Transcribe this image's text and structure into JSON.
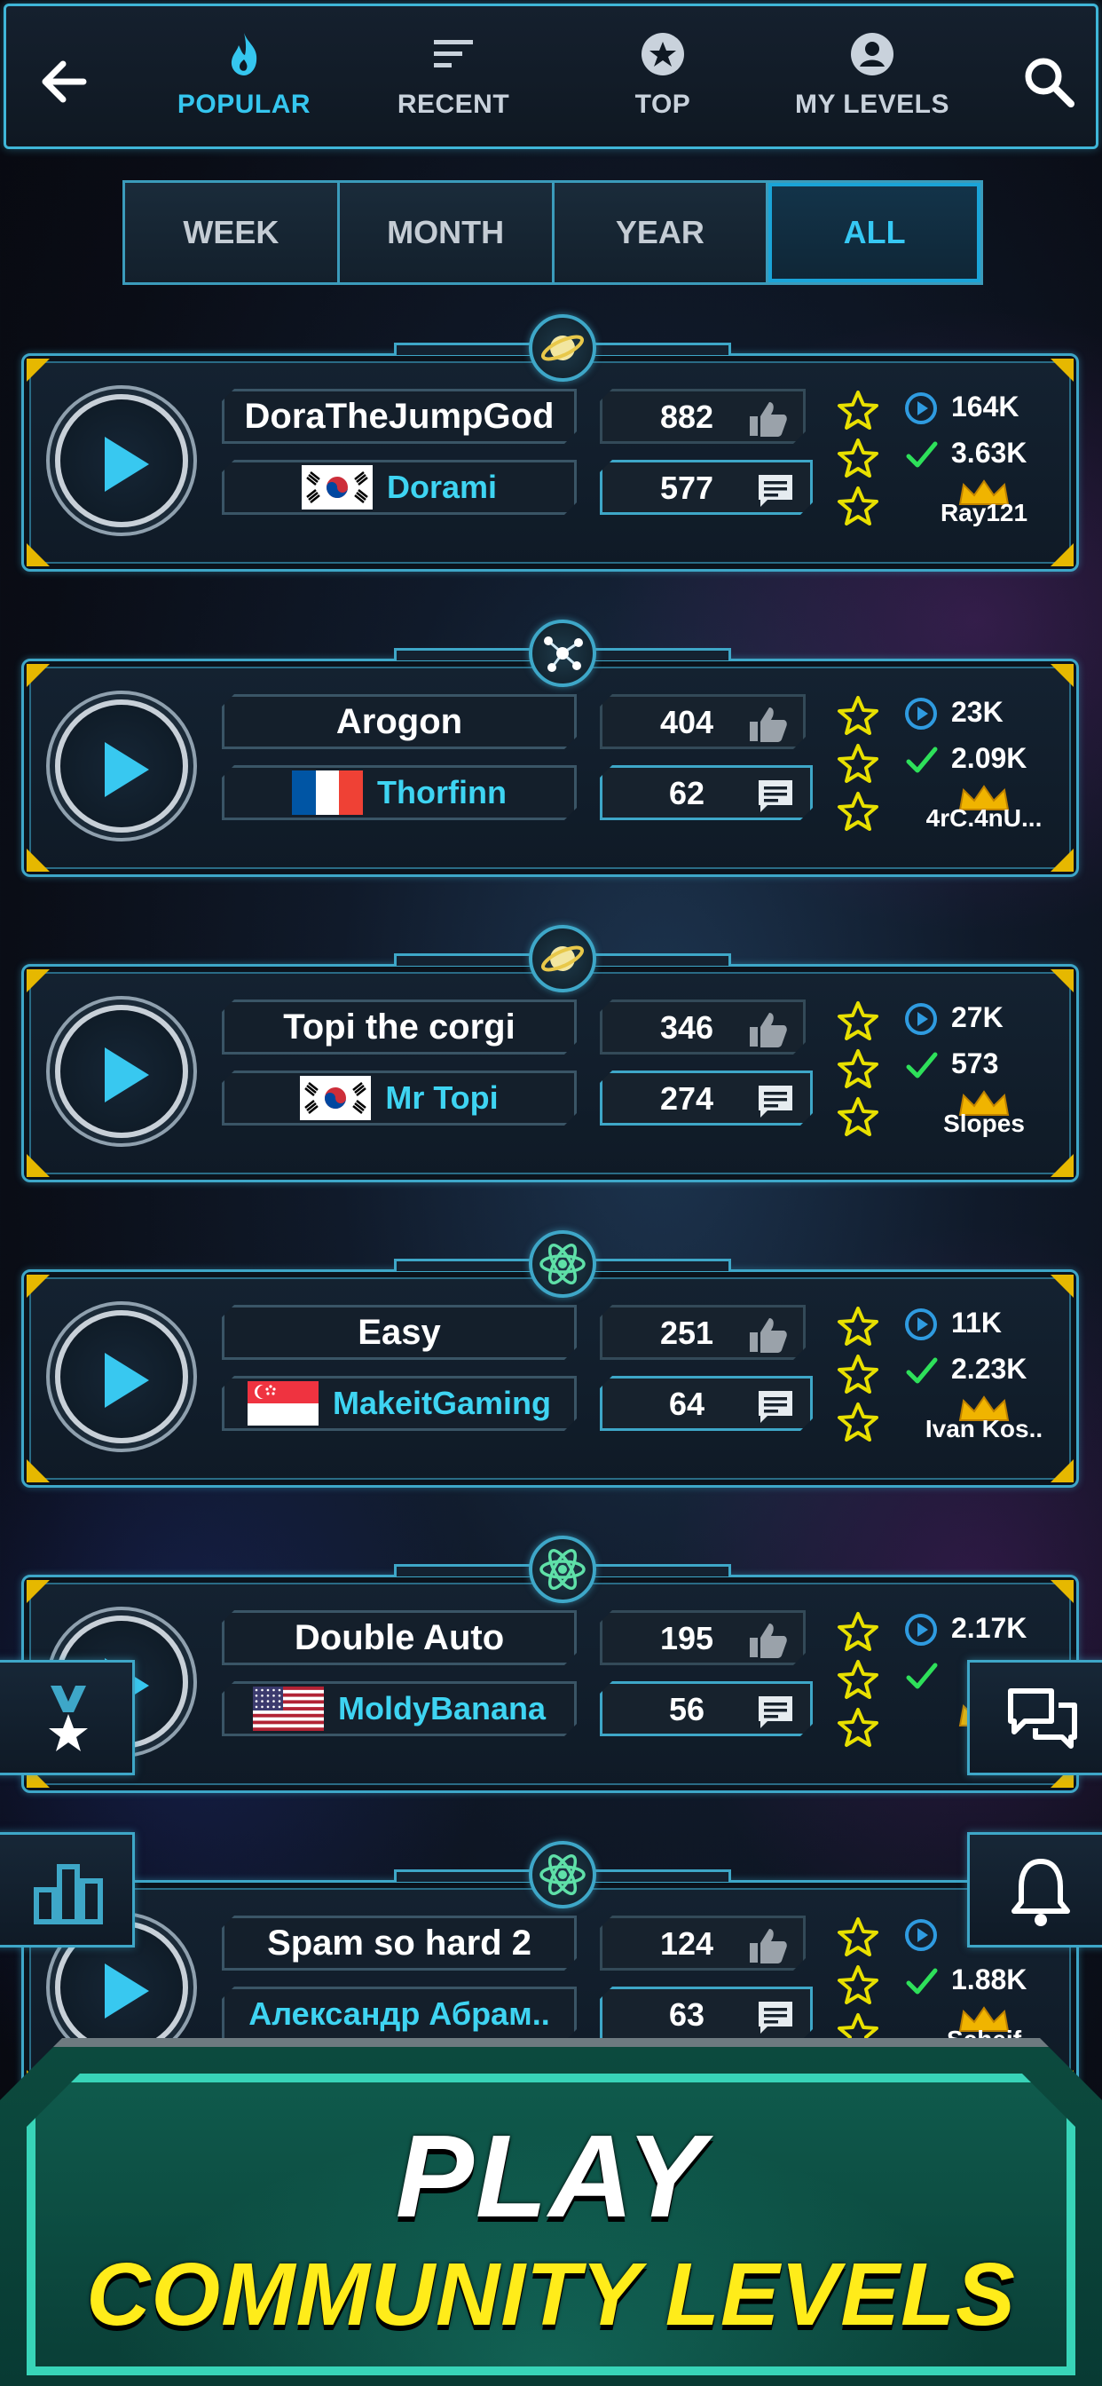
{
  "nav": {
    "tabs": [
      {
        "label": "POPULAR",
        "icon": "flame-icon",
        "active": true
      },
      {
        "label": "RECENT",
        "icon": "lines-icon",
        "active": false
      },
      {
        "label": "TOP",
        "icon": "star-badge-icon",
        "active": false
      },
      {
        "label": "MY LEVELS",
        "icon": "user-icon",
        "active": false
      }
    ]
  },
  "periods": [
    "WEEK",
    "MONTH",
    "YEAR",
    "ALL"
  ],
  "active_period": "ALL",
  "levels": [
    {
      "name": "DoraTheJumpGod",
      "author": "Dorami",
      "flag": "south-korea",
      "likes": "882",
      "comments": "577",
      "plays": "164K",
      "completions": "3.63K",
      "record_holder": "Ray121",
      "category": "planet-icon"
    },
    {
      "name": "Arogon",
      "author": "Thorfinn",
      "flag": "france",
      "likes": "404",
      "comments": "62",
      "plays": "23K",
      "completions": "2.09K",
      "record_holder": "4rC.4nU...",
      "category": "molecule-icon"
    },
    {
      "name": "Topi the corgi",
      "author": "Mr Topi",
      "flag": "south-korea",
      "likes": "346",
      "comments": "274",
      "plays": "27K",
      "completions": "573",
      "record_holder": "Slopes",
      "category": "planet-icon"
    },
    {
      "name": "Easy",
      "author": "MakeitGaming",
      "flag": "singapore",
      "likes": "251",
      "comments": "64",
      "plays": "11K",
      "completions": "2.23K",
      "record_holder": "Ivan Kos..",
      "category": "atom-icon"
    },
    {
      "name": "Double Auto",
      "author": "MoldyBanana",
      "flag": "usa",
      "likes": "195",
      "comments": "56",
      "plays": "2.17K",
      "completions": "",
      "record_holder": "",
      "category": "atom-icon"
    },
    {
      "name": "Spam so hard 2",
      "author": "Александр Абрам..",
      "flag": "",
      "likes": "124",
      "comments": "63",
      "plays": "",
      "completions": "1.88K",
      "record_holder": "Scheif",
      "category": "atom-icon"
    }
  ],
  "banner": {
    "title": "PLAY",
    "subtitle": "COMMUNITY LEVELS"
  },
  "colors": {
    "accent": "#35c6ef",
    "star": "#e8e000",
    "author": "#3ed4f2",
    "subtitle": "#ffec1a"
  }
}
